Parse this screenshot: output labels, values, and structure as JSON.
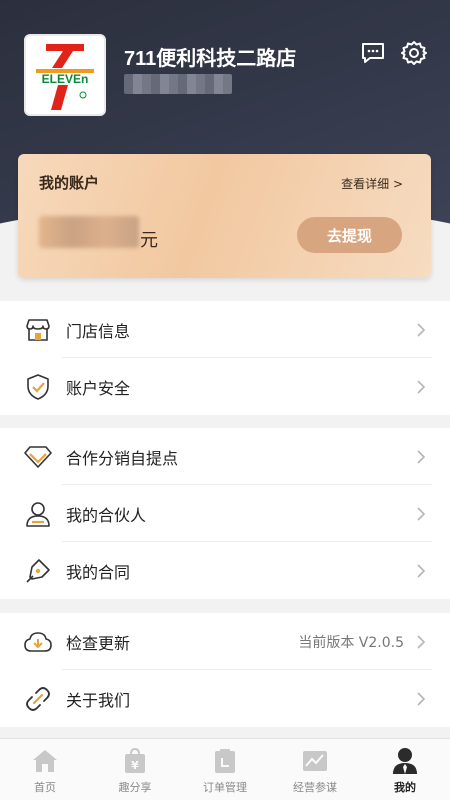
{
  "header": {
    "store_name": "711便利科技二路店",
    "logo_text": "ELEVEN"
  },
  "account": {
    "title": "我的账户",
    "detail_link": "查看详细 >",
    "balance_unit": "元",
    "withdraw_label": "去提现"
  },
  "menu_groups": [
    {
      "items": [
        {
          "label": "门店信息",
          "icon": "store-icon"
        },
        {
          "label": "账户安全",
          "icon": "shield-check-icon"
        }
      ]
    },
    {
      "items": [
        {
          "label": "合作分销自提点",
          "icon": "diamond-icon"
        },
        {
          "label": "我的合伙人",
          "icon": "person-icon"
        },
        {
          "label": "我的合同",
          "icon": "pen-icon"
        }
      ]
    },
    {
      "items": [
        {
          "label": "检查更新",
          "icon": "cloud-update-icon",
          "extra": "当前版本 V2.0.5"
        },
        {
          "label": "关于我们",
          "icon": "link-icon"
        }
      ]
    }
  ],
  "tabbar": {
    "tabs": [
      {
        "label": "首页",
        "icon": "home-icon"
      },
      {
        "label": "趣分享",
        "icon": "share-bag-icon"
      },
      {
        "label": "订单管理",
        "icon": "order-icon"
      },
      {
        "label": "经营参谋",
        "icon": "chart-icon"
      },
      {
        "label": "我的",
        "icon": "profile-icon"
      }
    ],
    "active_index": 4
  },
  "colors": {
    "header_bg": "#2f3341",
    "card_bg": "#f2c8a0",
    "withdraw_btn": "#d7a57f",
    "icon_accent": "#e8a33c"
  }
}
